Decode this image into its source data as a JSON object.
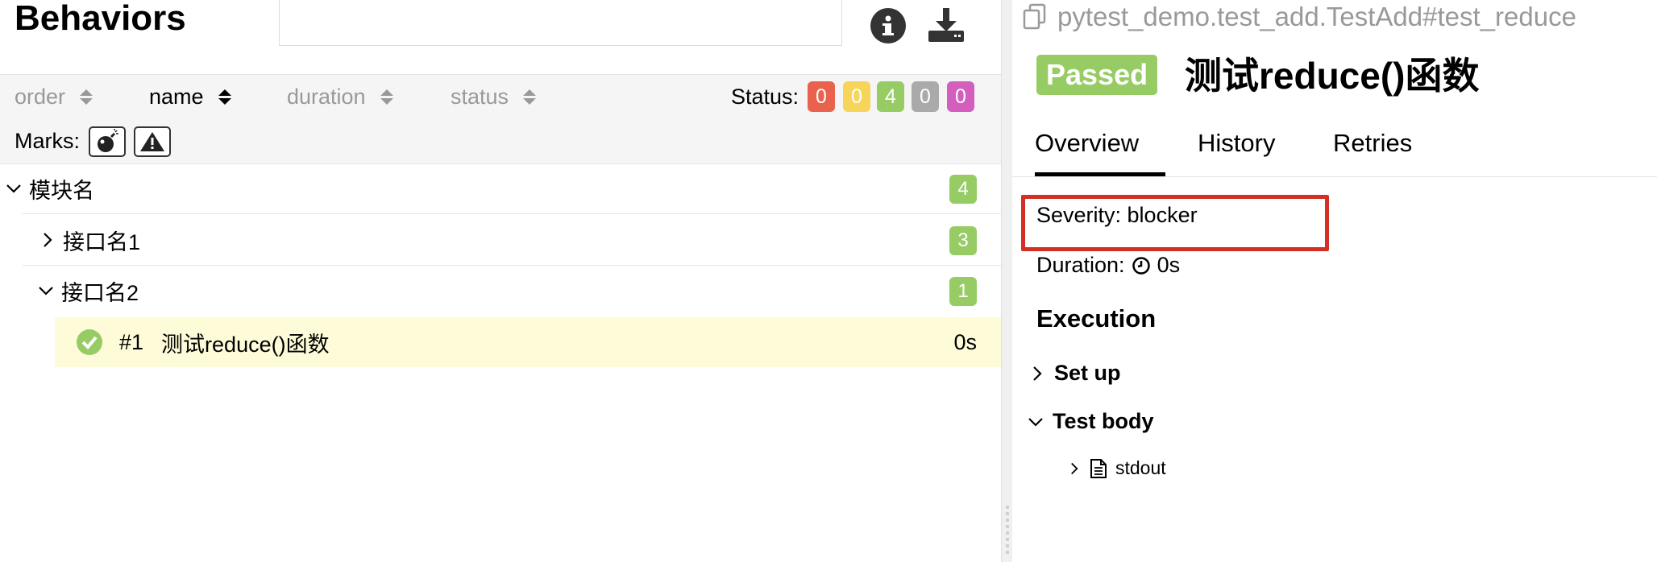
{
  "left": {
    "title": "Behaviors",
    "sort_columns": [
      {
        "label": "order"
      },
      {
        "label": "name"
      },
      {
        "label": "duration"
      },
      {
        "label": "status"
      }
    ],
    "status_label": "Status:",
    "status_counts": [
      {
        "value": "0",
        "color": "#e8624d"
      },
      {
        "value": "0",
        "color": "#f7d55a"
      },
      {
        "value": "4",
        "color": "#97cc64"
      },
      {
        "value": "0",
        "color": "#aaaaaa"
      },
      {
        "value": "0",
        "color": "#d35ebe"
      }
    ],
    "marks_label": "Marks:",
    "marks": [
      "bomb-icon",
      "warning-icon"
    ],
    "tree": {
      "module": {
        "label": "模块名",
        "count": "4"
      },
      "interface1": {
        "label": "接口名1",
        "count": "3"
      },
      "interface2": {
        "label": "接口名2",
        "count": "1"
      },
      "test": {
        "index": "#1",
        "name": "测试reduce()函数",
        "duration": "0s"
      }
    }
  },
  "right": {
    "test_path": "pytest_demo.test_add.TestAdd#test_reduce",
    "status_badge": "Passed",
    "title": "测试reduce()函数",
    "tabs": [
      "Overview",
      "History",
      "Retries"
    ],
    "severity": "Severity: blocker",
    "duration_label": "Duration:",
    "duration_value": "0s",
    "execution_title": "Execution",
    "steps": {
      "setup": "Set up",
      "test_body": "Test body",
      "stdout": "stdout"
    }
  }
}
